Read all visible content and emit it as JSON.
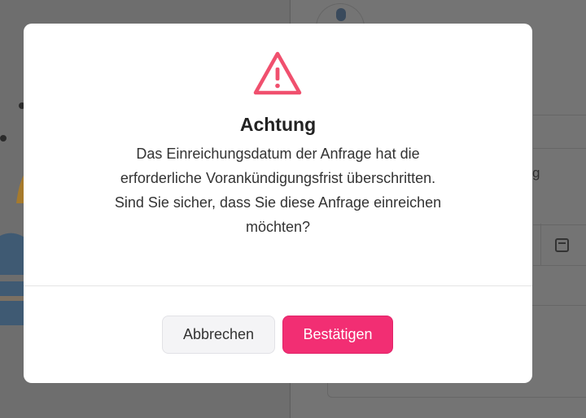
{
  "dialog": {
    "title": "Achtung",
    "message": "Das Einreichungsdatum der Anfrage hat die erforderliche Vorankündigungsfrist überschritten. Sind Sie sicher, dass Sie diese Anfrage einreichen möchten?",
    "icon": "warning-triangle-icon",
    "accent_color": "#f0506e",
    "buttons": {
      "cancel_label": "Abbrechen",
      "confirm_label": "Bestätigen",
      "confirm_color": "#f22e73"
    }
  },
  "background": {
    "partial_text": "g"
  }
}
